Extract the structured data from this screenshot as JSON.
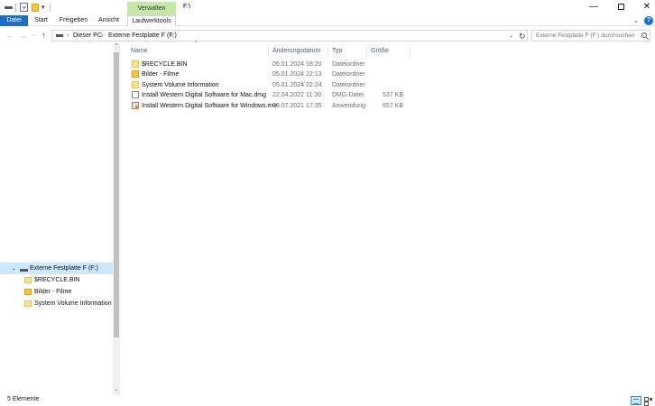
{
  "window": {
    "title_path": "F:\\",
    "minimize_glyph": "—",
    "close_glyph": "✕"
  },
  "quick_access": {
    "dropdown_glyph": "▾"
  },
  "ribbon": {
    "context_group": "Verwalten",
    "tabs": {
      "datei": "Datei",
      "start": "Start",
      "freigeben": "Freigeben",
      "ansicht": "Ansicht",
      "laufwerktools": "Laufwerktools"
    },
    "collapse_glyph": "⌄",
    "help_glyph": "?"
  },
  "address": {
    "back_glyph": "←",
    "forward_glyph": "→",
    "recent_glyph": "⌄",
    "up_glyph": "↑",
    "separator": "›",
    "crumbs": {
      "pc": "Dieser PC",
      "drive": "Externe Festplatte F (F:)"
    },
    "dropdown_glyph": "⌄",
    "refresh_glyph": "↻"
  },
  "search": {
    "placeholder": "Externe Festplatte F (F:) durchsuchen"
  },
  "columns": {
    "name": "Name",
    "date": "Änderungsdatum",
    "type": "Typ",
    "size": "Größe",
    "sort_glyph": "^"
  },
  "files": [
    {
      "name": "$RECYCLE.BIN",
      "date": "05.01.2024 18:20",
      "type": "Dateiordner",
      "size": "",
      "icon": "folder-pale-icon"
    },
    {
      "name": "Bilder - Filme",
      "date": "05.01.2024 22:13",
      "type": "Dateiordner",
      "size": "",
      "icon": "folder-icon"
    },
    {
      "name": "System Volume Information",
      "date": "05.01.2024 22:24",
      "type": "Dateiordner",
      "size": "",
      "icon": "folder-pale-icon"
    },
    {
      "name": "Install Western Digital Software for Mac.dmg",
      "date": "22.04.2022 11:39",
      "type": "DMG-Datei",
      "size": "537 KB",
      "icon": "file-icon"
    },
    {
      "name": "Install Western Digital Software for Windows.exe",
      "date": "09.07.2021 17:35",
      "type": "Anwendung",
      "size": "657 KB",
      "icon": "exe-icon"
    }
  ],
  "tree": {
    "expand_glyph": "⌄",
    "drive": "Externe Festplatte F (F:)",
    "children": [
      "$RECYCLE.BIN",
      "Bilder - Filme",
      "System Volume Information"
    ]
  },
  "scroll": {
    "up_glyph": "^",
    "down_glyph": "⌄"
  },
  "status": {
    "count": "5 Elemente"
  },
  "colors": {
    "accent": "#1a6ec4",
    "context_tab": "#c5e8a9",
    "selection": "#cce8ff",
    "folder": "#f5c542"
  }
}
